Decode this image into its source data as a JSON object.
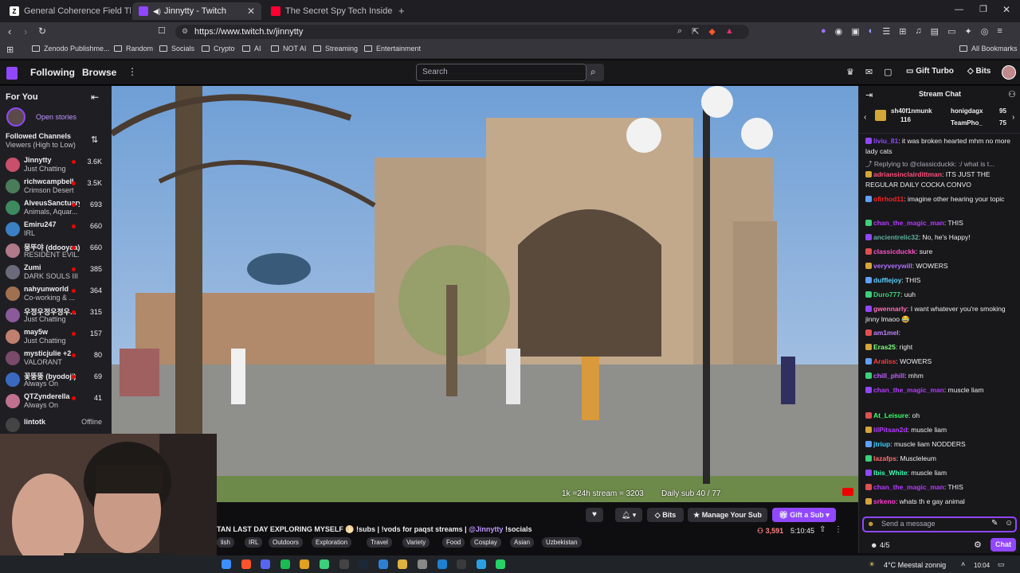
{
  "browser": {
    "tabs": [
      {
        "favicon": "Z",
        "title": "General Coherence Field Theory (GC"
      },
      {
        "favicon": "twitch",
        "title": "Jinnytty - Twitch",
        "audio": "speaker-icon"
      },
      {
        "favicon": "youtube",
        "title": "The Secret Spy Tech Inside Every Cre"
      }
    ],
    "url": "https://www.twitch.tv/jinnytty",
    "bookmarks": [
      "Zenodo Publishme...",
      "Random",
      "Socials",
      "Crypto",
      "AI",
      "NOT AI",
      "Streaming",
      "Entertainment"
    ],
    "all_bookmarks": "All Bookmarks"
  },
  "twitch": {
    "nav": {
      "following": "Following",
      "browse": "Browse",
      "search_placeholder": "Search",
      "gift_turbo": "Gift Turbo",
      "bits": "Bits"
    },
    "sidebar": {
      "for_you": "For You",
      "open_stories": "Open stories",
      "followed_title": "Followed Channels",
      "followed_sort": "Viewers (High to Low)",
      "channels": [
        {
          "name": "Jinnytty",
          "game": "Just Chatting",
          "viewers": "3.6K",
          "color": "#c94f6a"
        },
        {
          "name": "richwcampbell",
          "game": "Crimson Desert",
          "viewers": "3.5K",
          "color": "#4a7c59"
        },
        {
          "name": "AlveusSanctuary",
          "game": "Animals, Aquar...",
          "viewers": "693",
          "color": "#3d8a5f"
        },
        {
          "name": "Emiru247",
          "game": "IRL",
          "viewers": "660",
          "color": "#3b7fc4"
        },
        {
          "name": "뭉뚜야 (ddooyaa)",
          "game": "RESIDENT EVIL...",
          "viewers": "660",
          "color": "#b07a8a"
        },
        {
          "name": "Zumi",
          "game": "DARK SOULS III",
          "viewers": "385",
          "color": "#6a6a7a"
        },
        {
          "name": "nahyunworld",
          "game": "Co-working & ...",
          "viewers": "364",
          "color": "#a07050"
        },
        {
          "name": "우정우정우정우...",
          "game": "Just Chatting",
          "viewers": "315",
          "color": "#8a5a9a"
        },
        {
          "name": "may5w",
          "game": "Just Chatting",
          "viewers": "157",
          "color": "#c08070"
        },
        {
          "name": "mysticjulie +2",
          "game": "VALORANT",
          "viewers": "80",
          "color": "#7a4a6a"
        },
        {
          "name": "꽃뚱뚱 (byodoji)",
          "game": "Always On",
          "viewers": "69",
          "color": "#3a6ac0"
        },
        {
          "name": "QTZynderella",
          "game": "Always On",
          "viewers": "41",
          "color": "#c07090"
        }
      ],
      "offline_channel": {
        "name": "lintotk",
        "status": "Offline"
      }
    },
    "video": {
      "overlay_counter": "1k =24h stream = 3203",
      "overlay_daily": "Daily sub 40 / 77"
    },
    "stream_info": {
      "title": "TAN LAST DAY EXPLORING MYSELF 🌕 !subs | !vods for paqst streams |",
      "mention": "@Jinnytty",
      "socials": "!socials",
      "viewers": "3,591",
      "uptime": "5:10:45",
      "tags": [
        "lish",
        "IRL",
        "Outdoors",
        "Exploration",
        "Travel",
        "Variety",
        "Food",
        "Cosplay",
        "Asian",
        "Uzbekistan"
      ],
      "bits_label": "Bits",
      "manage_sub": "Manage Your Sub",
      "gift_sub": "Gift a Sub"
    },
    "chat": {
      "title": "Stream Chat",
      "leaderboard": [
        {
          "name": "sh40f1nmunk",
          "value": "116"
        },
        {
          "name": "honigdagx",
          "value": "95"
        },
        {
          "name": "TeamPho_",
          "value": "75"
        }
      ],
      "messages": [
        {
          "user": "liviu_81",
          "color": "#9147ff",
          "text": ": it was broken hearted mhm no more lady cats"
        },
        {
          "user": "",
          "color": "#adadb8",
          "text": "Replying to @classicduckk: :/ what is t..."
        },
        {
          "user": "adriansinclairdittman",
          "color": "#ff4f7a",
          "text": ": ITS JUST THE REGULAR DAILY COCKA CONVO"
        },
        {
          "user": "ofirhod11",
          "color": "#ff2222",
          "text": ": imagine other hearing your topic"
        },
        {
          "user": "chan_the_magic_man",
          "color": "#b43bff",
          "text": ": THIS"
        },
        {
          "user": "ancientrelic32",
          "color": "#5fb0a0",
          "text": ": No, he's Happy!"
        },
        {
          "user": "classicduckk",
          "color": "#ff4fc8",
          "text": ": sure"
        },
        {
          "user": "veryverywill",
          "color": "#b070ff",
          "text": ": WOWERS"
        },
        {
          "user": "dufflejoy",
          "color": "#5fd0ff",
          "text": ": THIS"
        },
        {
          "user": "Duro777",
          "color": "#3bd07a",
          "text": ": uuh"
        },
        {
          "user": "gwennarly",
          "color": "#ff6fb8",
          "text": ": I want whatever you're smoking jinny lmaoo 😂"
        },
        {
          "user": "am1mel",
          "color": "#c080ff",
          "text": ":"
        },
        {
          "user": "Eras25",
          "color": "#80ff80",
          "text": ": right"
        },
        {
          "user": "Araliss",
          "color": "#ff3b3b",
          "text": ": WOWERS"
        },
        {
          "user": "chill_phill",
          "color": "#c060ff",
          "text": ": mhm"
        },
        {
          "user": "chan_the_magic_man",
          "color": "#b43bff",
          "text": ": muscle liam"
        },
        {
          "user": "At_Leisure",
          "color": "#3bff6a",
          "text": ": oh"
        },
        {
          "user": "lilPitsan2d",
          "color": "#b43bff",
          "text": ": muscle liam"
        },
        {
          "user": "jtriup",
          "color": "#3bd0ff",
          "text": ": muscle liam NODDERS"
        },
        {
          "user": "lazafps",
          "color": "#ff6f6f",
          "text": ": Muscleleum"
        },
        {
          "user": "Ibis_White",
          "color": "#3bffb0",
          "text": ": muscle liam"
        },
        {
          "user": "chan_the_magic_man",
          "color": "#b43bff",
          "text": ": THIS"
        },
        {
          "user": "srkeno",
          "color": "#ff3bd0",
          "text": ": whats th e gay animal"
        }
      ],
      "input_placeholder": "Send a message",
      "points": "4/5",
      "chat_button": "Chat"
    }
  },
  "taskbar": {
    "weather": "4°C  Meestal zonnig",
    "time": "10:04"
  },
  "colors": {
    "twitch_purple": "#9147ff",
    "live_red": "#eb0400"
  }
}
